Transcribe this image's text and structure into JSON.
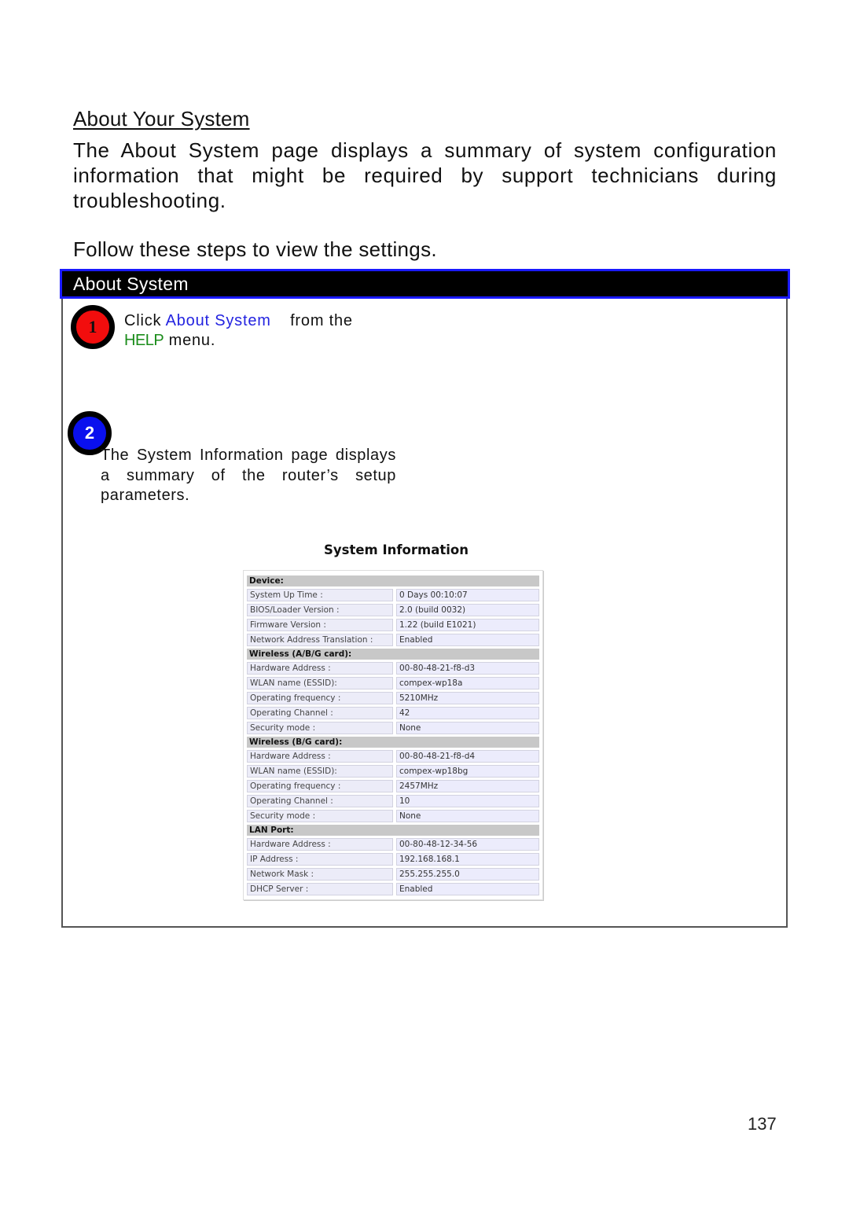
{
  "document": {
    "section_title": "About Your System",
    "intro": "The About System page displays a summary of system configuration information that might be required by support technicians during troubleshooting.",
    "follow_steps": "Follow these steps to view the settings.",
    "page_number": "137"
  },
  "panel": {
    "header": "About System",
    "steps": [
      {
        "number": "1",
        "badge_color": "#f20d0d",
        "text_prefix": "Click",
        "link_text": "About System",
        "text_middle": "from the",
        "menu_name": "HELP",
        "text_suffix": "menu."
      },
      {
        "number": "2",
        "badge_color": "#0a10ee",
        "text": "The System Information page displays a summary of the router’s setup parameters."
      }
    ]
  },
  "system_information": {
    "title": "System Information",
    "sections": [
      {
        "name": "Device:",
        "rows": [
          {
            "label": "System Up Time :",
            "value": "0 Days 00:10:07"
          },
          {
            "label": "BIOS/Loader Version :",
            "value": "2.0 (build 0032)"
          },
          {
            "label": "Firmware Version :",
            "value": "1.22 (build E1021)"
          },
          {
            "label": "Network Address Translation :",
            "value": "Enabled"
          }
        ]
      },
      {
        "name": "Wireless (A/B/G card):",
        "rows": [
          {
            "label": "Hardware Address :",
            "value": "00-80-48-21-f8-d3"
          },
          {
            "label": "WLAN name (ESSID):",
            "value": "compex-wp18a"
          },
          {
            "label": "Operating frequency :",
            "value": "5210MHz"
          },
          {
            "label": "Operating Channel :",
            "value": "42"
          },
          {
            "label": "Security mode :",
            "value": "None"
          }
        ]
      },
      {
        "name": "Wireless (B/G card):",
        "rows": [
          {
            "label": "Hardware Address :",
            "value": "00-80-48-21-f8-d4"
          },
          {
            "label": "WLAN name (ESSID):",
            "value": "compex-wp18bg"
          },
          {
            "label": "Operating frequency :",
            "value": "2457MHz"
          },
          {
            "label": "Operating Channel :",
            "value": "10"
          },
          {
            "label": "Security mode :",
            "value": "None"
          }
        ]
      },
      {
        "name": "LAN Port:",
        "rows": [
          {
            "label": "Hardware Address :",
            "value": "00-80-48-12-34-56"
          },
          {
            "label": "IP Address :",
            "value": "192.168.168.1"
          },
          {
            "label": "Network Mask :",
            "value": "255.255.255.0"
          },
          {
            "label": "DHCP Server :",
            "value": "Enabled"
          }
        ]
      }
    ]
  }
}
